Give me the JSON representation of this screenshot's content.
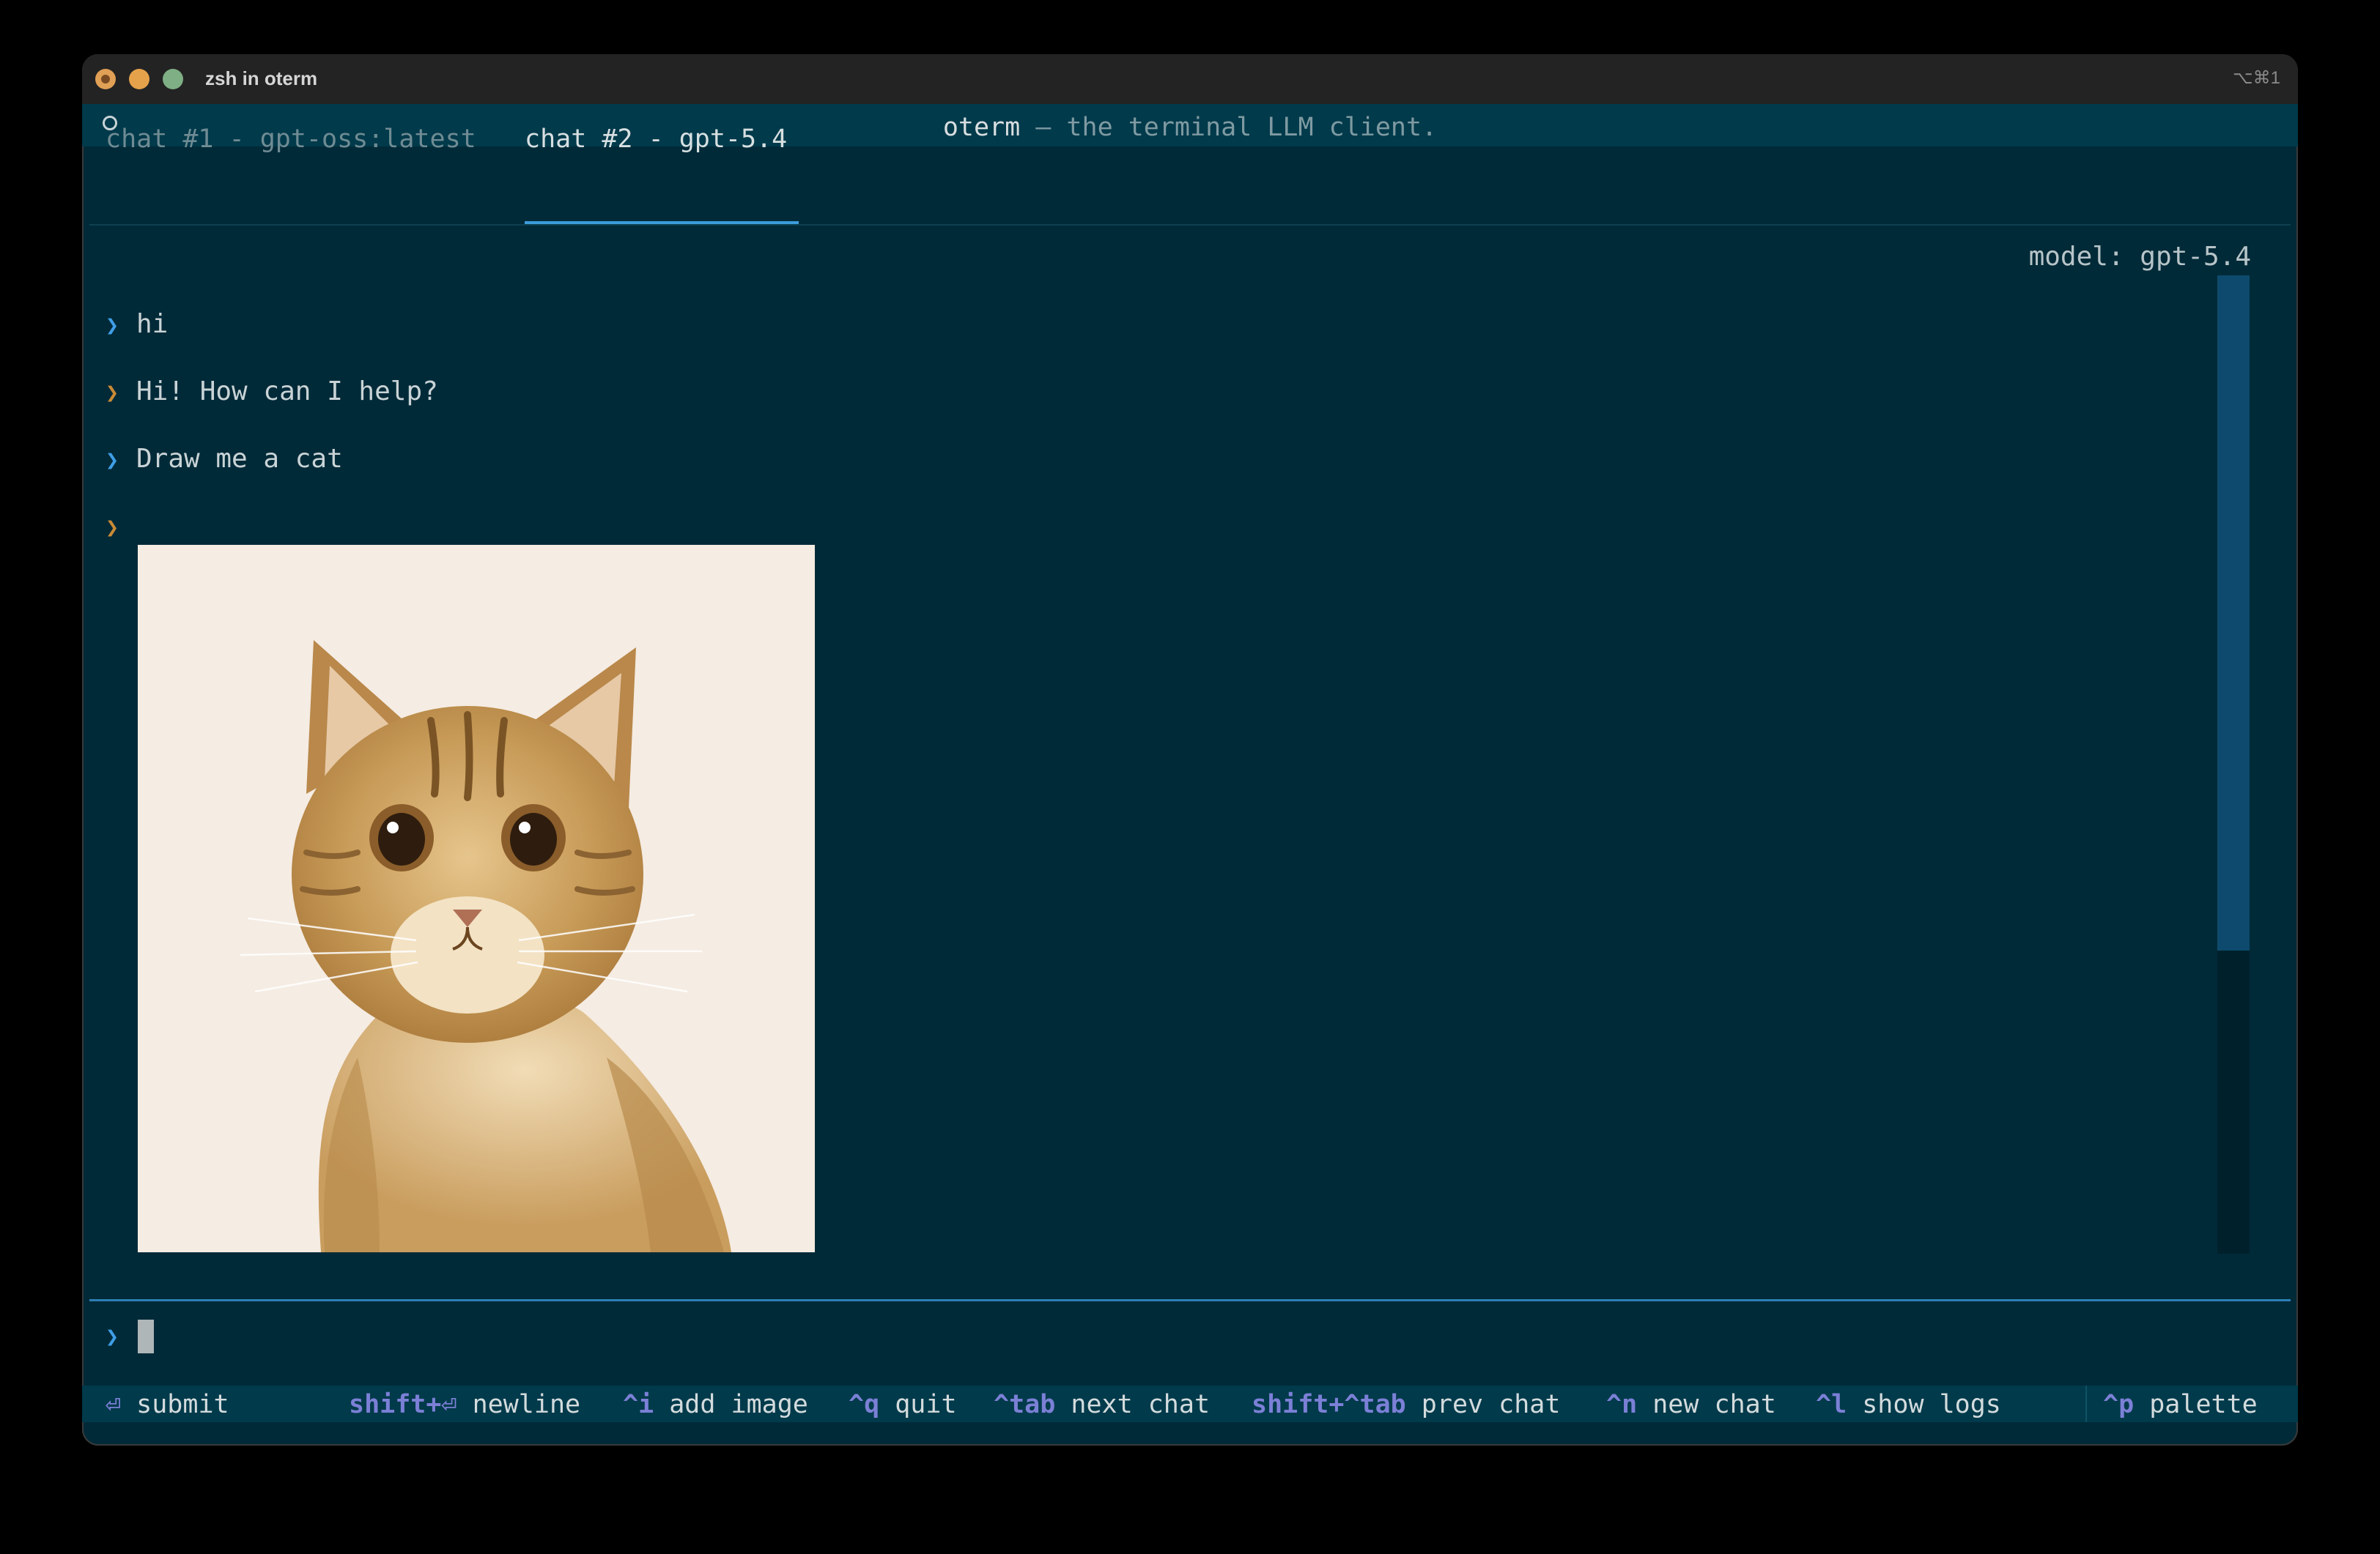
{
  "window": {
    "title": "zsh in oterm",
    "shortcut": "⌥⌘1"
  },
  "header": {
    "app": "oterm",
    "separator": " — ",
    "tagline": "the terminal LLM client."
  },
  "tabs": [
    {
      "label": "chat #1 - gpt-oss:latest",
      "active": false
    },
    {
      "label": "chat #2 - gpt-5.4",
      "active": true
    }
  ],
  "model_label": "model: gpt-5.4",
  "messages": [
    {
      "role": "user",
      "prompt": "❯",
      "text": "hi"
    },
    {
      "role": "assistant",
      "prompt": "❯",
      "text": "Hi! How can I help?"
    },
    {
      "role": "user",
      "prompt": "❯",
      "text": "Draw me a cat"
    },
    {
      "role": "assistant",
      "prompt": "❯",
      "text": ""
    }
  ],
  "input": {
    "prompt": "❯",
    "value": ""
  },
  "footer": [
    {
      "key": "⏎",
      "label": "submit"
    },
    {
      "key": "shift+⏎",
      "label": "newline"
    },
    {
      "key": "^i",
      "label": "add image"
    },
    {
      "key": "^q",
      "label": "quit"
    },
    {
      "key": "^tab",
      "label": "next chat"
    },
    {
      "key": "shift+^tab",
      "label": "prev chat"
    },
    {
      "key": "^n",
      "label": "new chat"
    },
    {
      "key": "^l",
      "label": "show logs"
    },
    {
      "key": "^p",
      "label": "palette"
    }
  ],
  "scrollbar": {
    "thumb_fraction": 0.69,
    "position": 0.0
  },
  "colors": {
    "background": "#002a38",
    "accent": "#3d9bd9",
    "user_prompt": "#3f9ee6",
    "assistant_prompt": "#c98a36",
    "footer_key": "#7b80d6"
  }
}
